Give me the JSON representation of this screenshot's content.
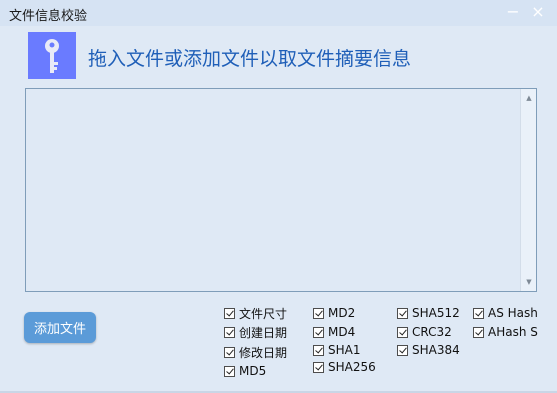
{
  "window": {
    "title": "文件信息校验",
    "minimize": "−",
    "close": "×"
  },
  "header": {
    "icon": "key-icon",
    "text": "拖入文件或添加文件以取文件摘要信息"
  },
  "textarea": {
    "value": ""
  },
  "toolbar": {
    "add_file_label": "添加文件"
  },
  "options": {
    "col1": [
      "文件尺寸",
      "创建日期",
      "修改日期",
      "MD5"
    ],
    "col2": [
      "MD2",
      "MD4",
      "SHA1",
      "SHA256"
    ],
    "col3": [
      "SHA512",
      "CRC32",
      "SHA384"
    ],
    "col4": [
      "AS Hash",
      "AHash S"
    ]
  },
  "colors": {
    "accent": "#5b9bd8",
    "heading": "#1f5fb8",
    "background": "#dfe9f5",
    "icon_bg": "#6a7bff"
  }
}
